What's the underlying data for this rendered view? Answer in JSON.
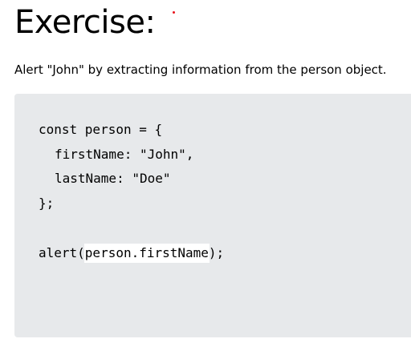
{
  "exercise": {
    "heading": "Exercise:",
    "instruction": "Alert \"John\" by extracting information from the person object."
  },
  "code": {
    "line1": "const person = {",
    "line2": "firstName: \"John\",",
    "line3": "lastName: \"Doe\"",
    "line4": "};",
    "alert_prefix": "alert(",
    "answer_value": "person.firstName",
    "alert_suffix": ");"
  },
  "colors": {
    "code_background": "#e7e9eb",
    "input_background": "#ffffff",
    "marker_red": "#e8141c"
  }
}
